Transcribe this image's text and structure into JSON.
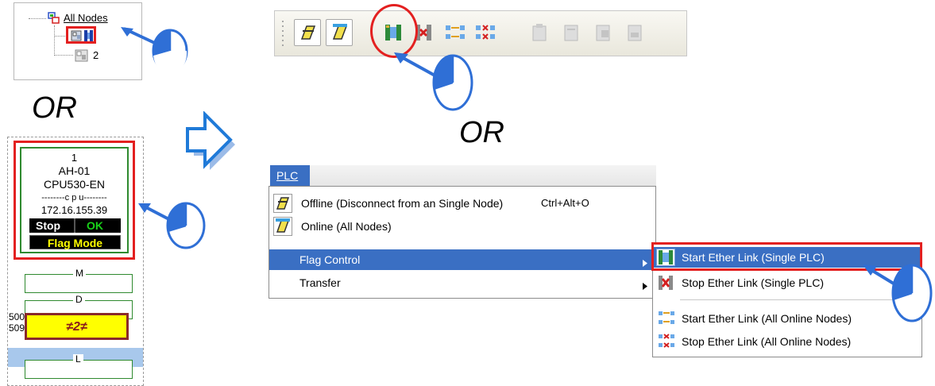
{
  "tree": {
    "root_label": "All Nodes",
    "child_label": "2"
  },
  "or_label": "OR",
  "node": {
    "number": "1",
    "model": "AH-01",
    "cpu": "CPU530-EN",
    "cpu_divider": "--------c p u--------",
    "ip": "172.16.155.39",
    "status_stop": "Stop",
    "status_ok": "OK",
    "flag_mode": "Flag Mode",
    "mem_m": "M",
    "mem_d": "D",
    "mem_l": "L",
    "range_start": "500",
    "range_end": "509",
    "link_badge": "≠2≠"
  },
  "menu": {
    "title": "PLC",
    "items": [
      {
        "label": "Offline (Disconnect from an Single Node)",
        "shortcut": "Ctrl+Alt+O"
      },
      {
        "label": "Online (All Nodes)"
      },
      {
        "label": "Flag Control"
      },
      {
        "label": "Transfer"
      }
    ],
    "submenu": [
      {
        "label": "Start Ether Link (Single PLC)"
      },
      {
        "label": "Stop Ether Link (Single PLC)"
      },
      {
        "label": "Start Ether Link (All Online Nodes)"
      },
      {
        "label": "Stop Ether Link (All Online Nodes)"
      }
    ]
  },
  "colors": {
    "highlight_red": "#e32020",
    "selection_blue": "#3a6fc3",
    "arrow_blue": "#2f6fd6",
    "status_green": "#19d219",
    "badge_yellow": "#ffff00",
    "node_border_green": "#2f8a2f"
  },
  "icons": {
    "pointer": "hand-cursor-icon",
    "flow_arrow": "right-arrow-icon"
  }
}
